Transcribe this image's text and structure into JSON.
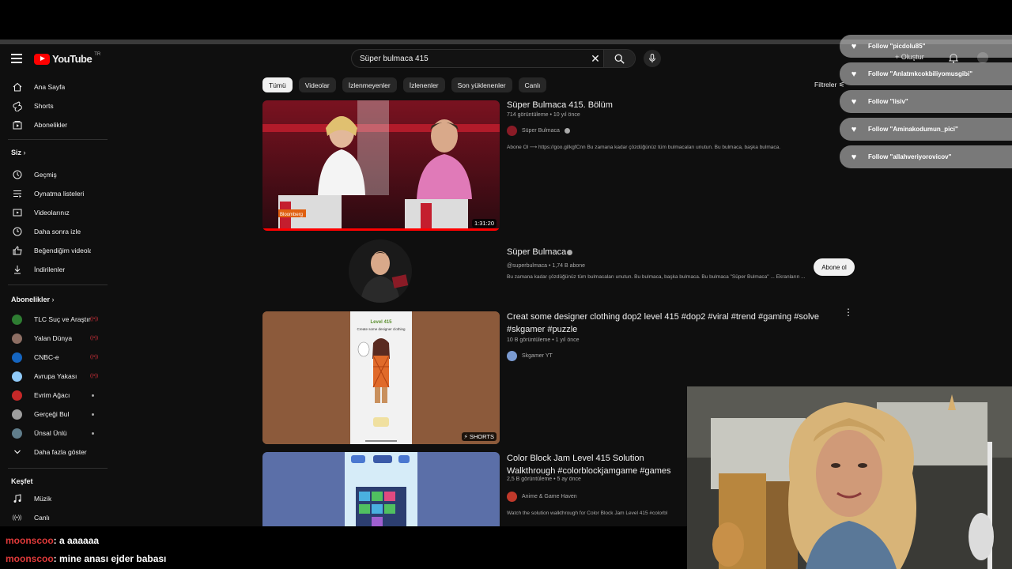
{
  "header": {
    "logo_text": "YouTube",
    "country_code": "TR",
    "search_value": "Süper bulmaca 415",
    "create_label": "Oluştur",
    "icons": [
      "menu-icon",
      "search-icon",
      "clear-icon",
      "mic-icon",
      "bell-icon",
      "plus-icon"
    ]
  },
  "sidebar": {
    "main": [
      {
        "label": "Ana Sayfa",
        "icon": "home-icon"
      },
      {
        "label": "Shorts",
        "icon": "shorts-icon"
      },
      {
        "label": "Abonelikler",
        "icon": "subscriptions-icon"
      }
    ],
    "you_header": "Siz",
    "you": [
      {
        "label": "Geçmiş",
        "icon": "history-icon"
      },
      {
        "label": "Oynatma listeleri",
        "icon": "playlist-icon"
      },
      {
        "label": "Videolarınız",
        "icon": "your-videos-icon"
      },
      {
        "label": "Daha sonra izle",
        "icon": "watch-later-icon"
      },
      {
        "label": "Beğendiğim videolar",
        "icon": "like-icon"
      },
      {
        "label": "İndirilenler",
        "icon": "download-icon"
      }
    ],
    "subs_header": "Abonelikler",
    "subs": [
      {
        "label": "TLC Suç ve Araştırma",
        "status": "live",
        "color": "#2e7d32"
      },
      {
        "label": "Yalan Dünya",
        "status": "live",
        "color": "#8d6e63"
      },
      {
        "label": "CNBC-e",
        "status": "live",
        "color": "#1565c0"
      },
      {
        "label": "Avrupa Yakası",
        "status": "live",
        "color": "#90caf9"
      },
      {
        "label": "Evrim Ağacı",
        "status": "new",
        "color": "#c62828"
      },
      {
        "label": "Gerçeği Bul",
        "status": "new",
        "color": "#9e9e9e"
      },
      {
        "label": "Ünsal Ünlü",
        "status": "new",
        "color": "#607d8b"
      }
    ],
    "show_more": "Daha fazla göster",
    "explore_header": "Keşfet",
    "explore": [
      {
        "label": "Müzik",
        "icon": "music-icon"
      },
      {
        "label": "Canlı",
        "icon": "live-icon"
      }
    ]
  },
  "chips": [
    "Tümü",
    "Videolar",
    "İzlenmeyenler",
    "İzlenenler",
    "Son yüklenenler",
    "Canlı"
  ],
  "filters_label": "Filtreler",
  "results": [
    {
      "title": "Süper Bulmaca 415. Bölüm",
      "meta": "714 görüntüleme • 10 yıl önce",
      "channel": "Süper Bulmaca",
      "description": "Abone Ol ⟶ https://goo.gl/kgfCnn Bu zamana kadar çözdüğünüz tüm bulmacaları unutun. Bu bulmaca, başka bulmaca.",
      "duration": "1:31:20"
    },
    {
      "title": "Creat some designer clothing dop2 level 415 #dop2 #viral #trend #gaming #solve #skgamer #puzzle",
      "meta": "10 B görüntüleme • 1 yıl önce",
      "channel": "Skgamer YT",
      "badge": "SHORTS"
    },
    {
      "title": "Color Block Jam Level 415 Solution Walkthrough #colorblockjamgame #games",
      "meta": "2,5 B görüntüleme • 5 ay önce",
      "channel": "Anime & Game Haven",
      "description": "Watch the solution walkthrough for Color Block Jam Level 415 #colorbl"
    }
  ],
  "channel_card": {
    "name": "Süper Bulmaca",
    "meta": "@superbulmaca • 1,74 B abone",
    "description": "Bu zamana kadar çözdüğünüz tüm bulmacaları unutun. Bu bulmaca, başka bulmaca. Bu bulmaca \"Süper Bulmaca\" ... Ekranların ...",
    "subscribe": "Abone ol"
  },
  "follows": [
    "Follow \"picdolu85\"",
    "Follow \"Anlatmkcokbiliyomusgibi\"",
    "Follow \"lisiv\"",
    "Follow \"Aminakodumun_pici\"",
    "Follow \"allahveriyorovicov\""
  ],
  "chat": [
    {
      "user": "moonscoo",
      "message": ": a aaaaaa"
    },
    {
      "user": "moonscoo",
      "message": ": mine anası ejder babası"
    }
  ],
  "thumb_texts": {
    "level": "Level 415",
    "prompt": "Create some designer clothing",
    "logo": "Bloomberg"
  }
}
